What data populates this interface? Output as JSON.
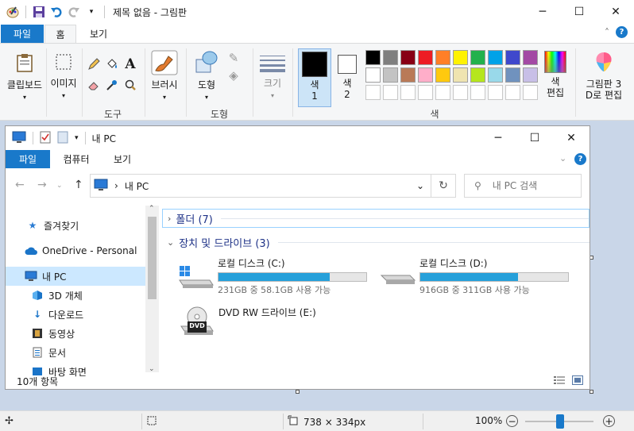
{
  "app": {
    "title": "제목 없음 - 그림판",
    "colors": {
      "accent": "#1979ca",
      "canvas_bg": "#c9d6e8",
      "ribbon_bg": "#f5f6f7",
      "drive_bar": "#26a0da"
    }
  },
  "quick_access": {
    "icons": [
      "paint-app-icon",
      "save-icon",
      "undo-icon",
      "redo-icon",
      "customize-dropdown-icon"
    ]
  },
  "ribbon_tabs": {
    "file": "파일",
    "home": "홈",
    "view": "보기"
  },
  "ribbon": {
    "clipboard_label": "클립보드",
    "image_label": "이미지",
    "tools_group": "도구",
    "brush_label": "브러시",
    "shape_label": "도형",
    "shapes_group": "도형",
    "size_label": "크기",
    "color1_label_1": "색",
    "color1_label_2": "1",
    "color2_label_1": "색",
    "color2_label_2": "2",
    "edit_color_label_1": "색",
    "edit_color_label_2": "편집",
    "paint3d_label_1": "그림판 3",
    "paint3d_label_2": "D로 편집",
    "colors_group": "색",
    "color1": "#000000",
    "color2": "#ffffff",
    "palette_row1": [
      "#000000",
      "#7f7f7f",
      "#880015",
      "#ed1c24",
      "#ff7f27",
      "#fff200",
      "#22b14c",
      "#00a2e8",
      "#3f48cc",
      "#a349a4"
    ],
    "palette_row2": [
      "#ffffff",
      "#c3c3c3",
      "#b97a57",
      "#ffaec9",
      "#ffc90e",
      "#efe4b0",
      "#b5e61d",
      "#99d9ea",
      "#7092be",
      "#c8bfe7"
    ],
    "palette_row3": [
      "#ffffff",
      "#ffffff",
      "#ffffff",
      "#ffffff",
      "#ffffff",
      "#ffffff",
      "#ffffff",
      "#ffffff",
      "#ffffff",
      "#ffffff"
    ]
  },
  "explorer": {
    "title": "내 PC",
    "tabs": {
      "file": "파일",
      "computer": "컴퓨터",
      "view": "보기"
    },
    "address": "내 PC",
    "search_placeholder": "내 PC 검색",
    "nav": {
      "quick_access": "즐겨찾기",
      "onedrive": "OneDrive - Personal",
      "this_pc": "내 PC",
      "objects3d": "3D 개체",
      "downloads": "다운로드",
      "videos": "동영상",
      "documents": "문서",
      "desktop": "바탕 화면"
    },
    "sections": {
      "folders": "폴더 (7)",
      "drives": "장치 및 드라이브 (3)"
    },
    "drives": [
      {
        "name": "로컬 디스크 (C:)",
        "free": "231GB 중 58.1GB 사용 가능",
        "used_fraction": 0.75
      },
      {
        "name": "로컬 디스크 (D:)",
        "free": "916GB 중 311GB 사용 가능",
        "used_fraction": 0.66
      },
      {
        "name": "DVD RW 드라이브 (E:)",
        "disc_label": "DVD"
      }
    ],
    "status": "10개 항목"
  },
  "statusbar": {
    "dimensions": "738 × 334px",
    "zoom": "100%",
    "zoom_level": 1.0
  }
}
